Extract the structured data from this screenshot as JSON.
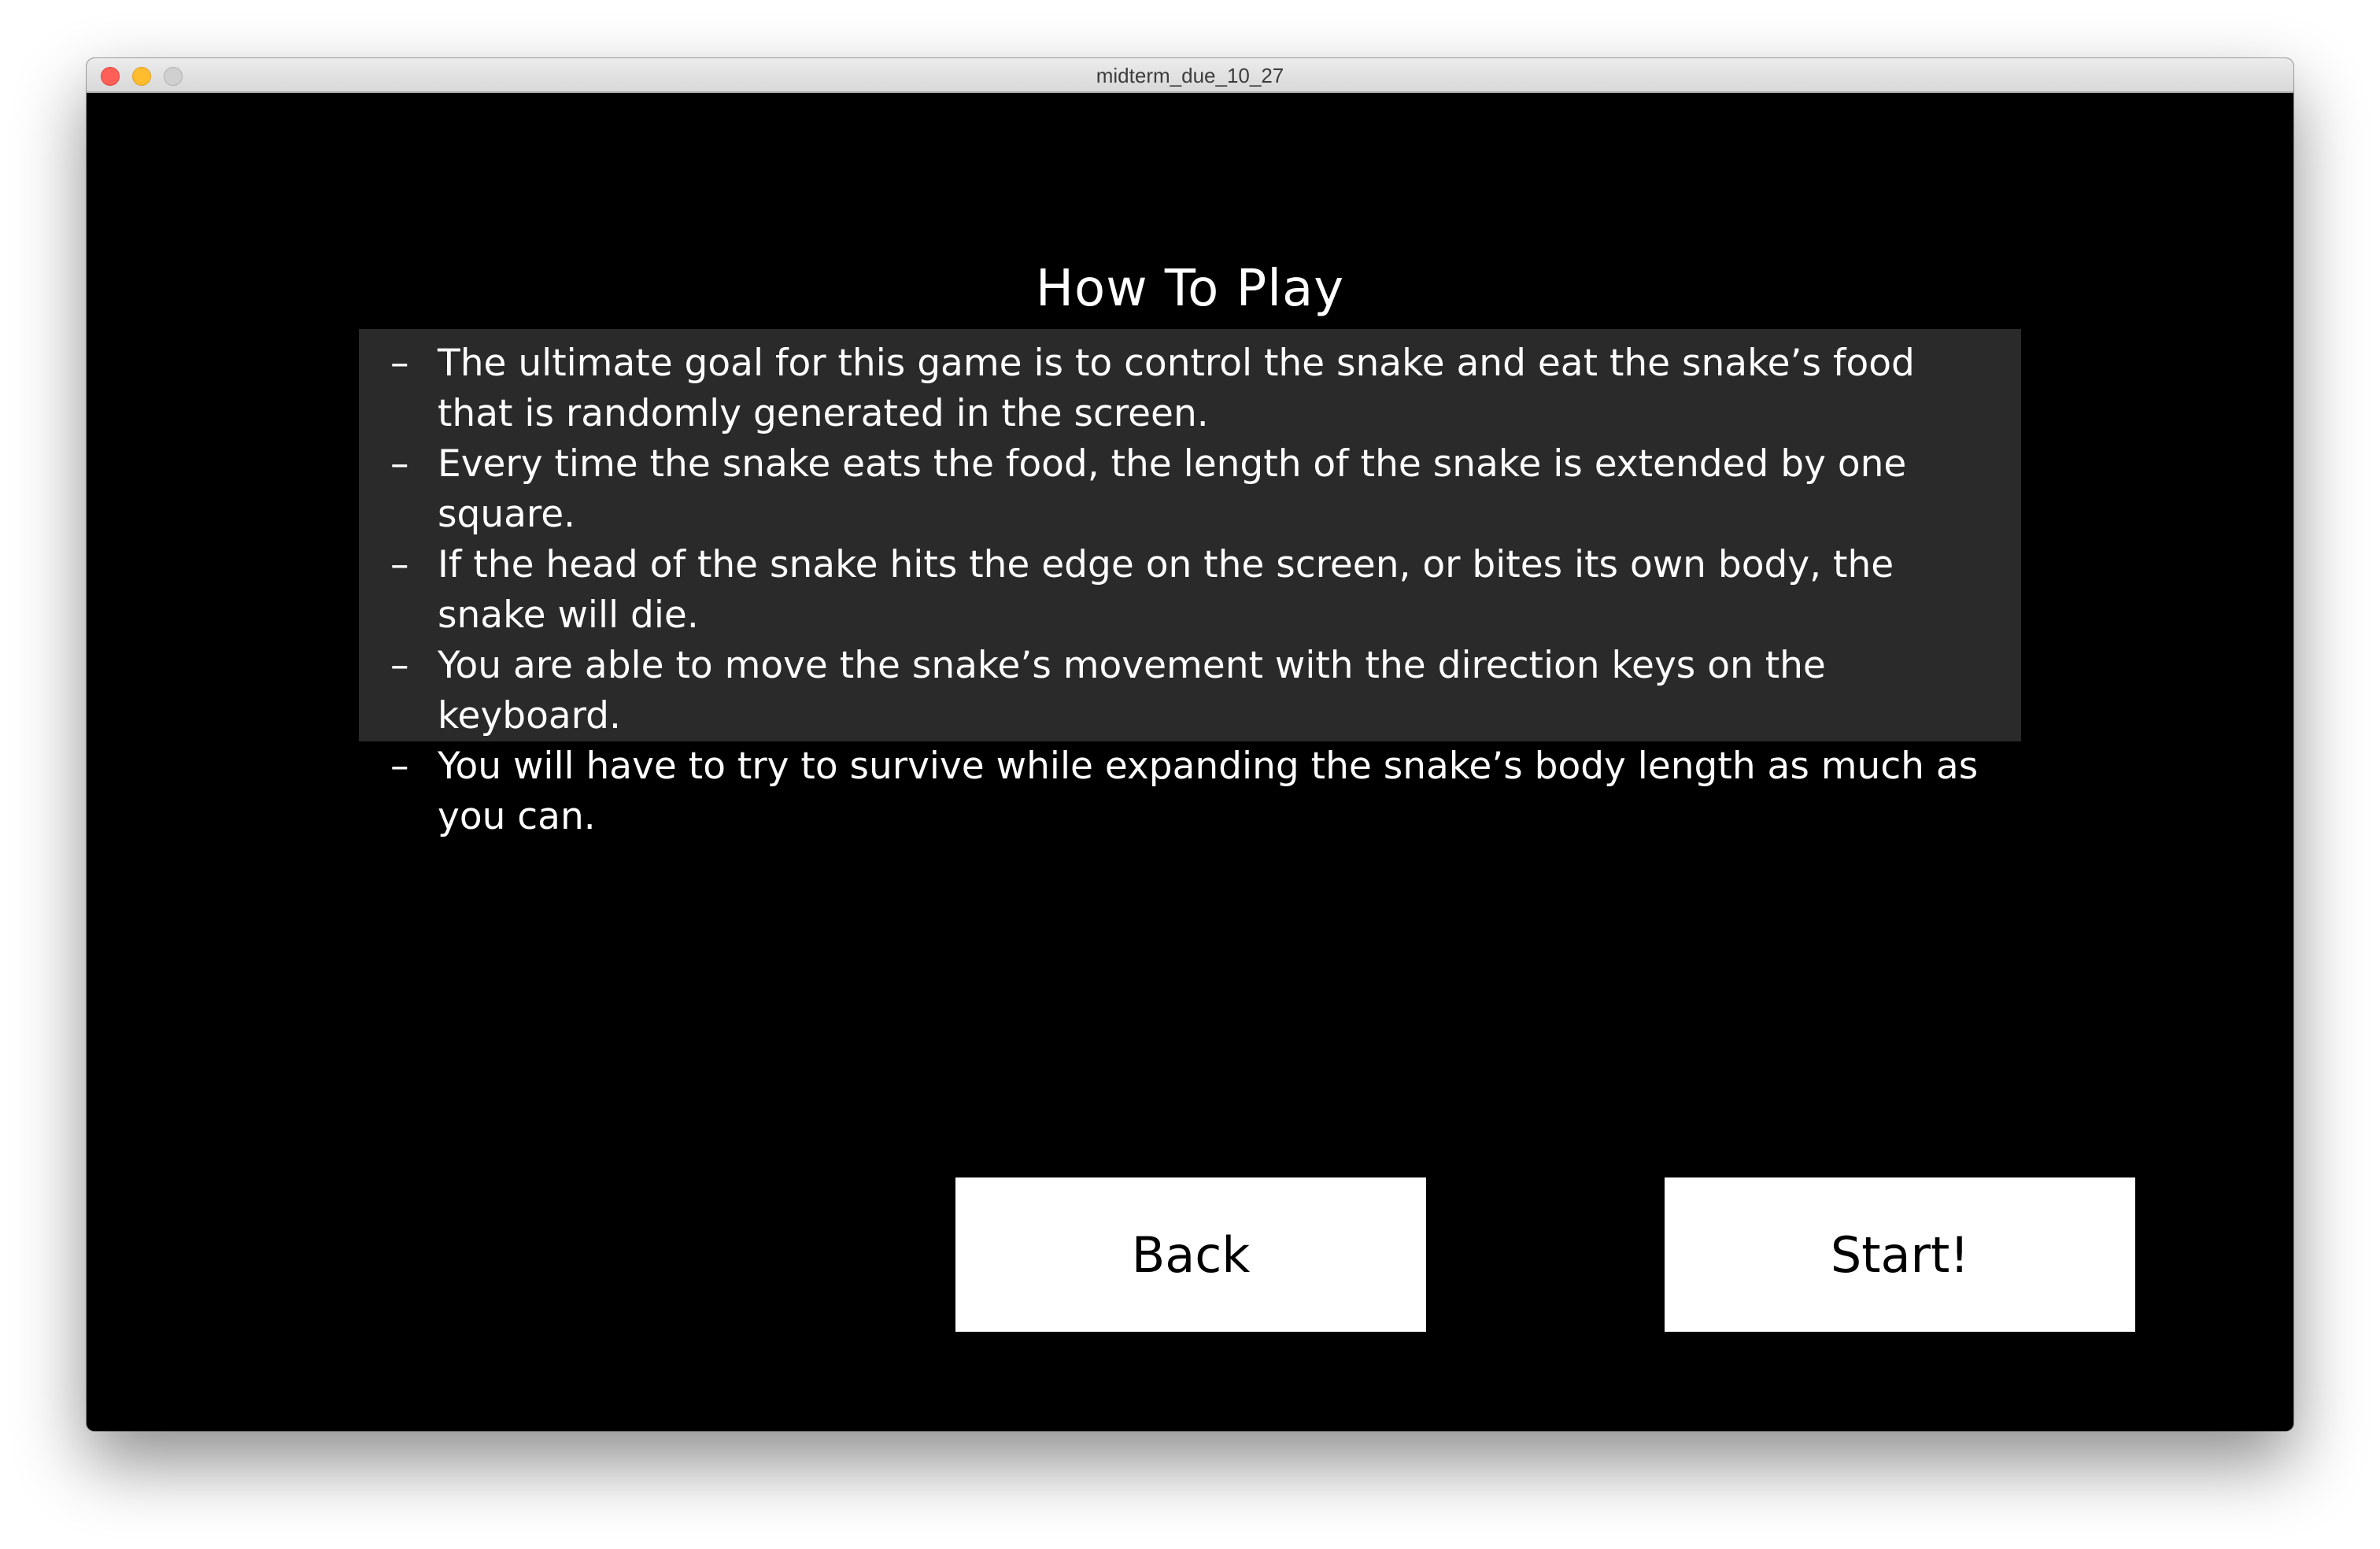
{
  "window": {
    "title": "midterm_due_10_27"
  },
  "screen": {
    "heading": "How To Play",
    "rules": [
      {
        "bullet": "–",
        "text": "The ultimate goal for this game is to control the snake and eat the snake’s food that is randomly generated in the screen."
      },
      {
        "bullet": "–",
        "text": "Every time the snake eats the food, the length of the snake is extended by one square."
      },
      {
        "bullet": "–",
        "text": "If the head of the snake hits the edge on the screen, or bites its own body, the snake will die."
      },
      {
        "bullet": "–",
        "text": "You are able to move the snake’s movement with the direction keys on the keyboard."
      },
      {
        "bullet": "–",
        "text": "You will have to try to survive while expanding the snake’s body length as much as you can."
      }
    ],
    "back_label": "Back",
    "start_label": "Start!"
  },
  "colors": {
    "background": "#000000",
    "panel": "#2a2a2a",
    "button": "#ffffff",
    "text": "#ffffff"
  }
}
